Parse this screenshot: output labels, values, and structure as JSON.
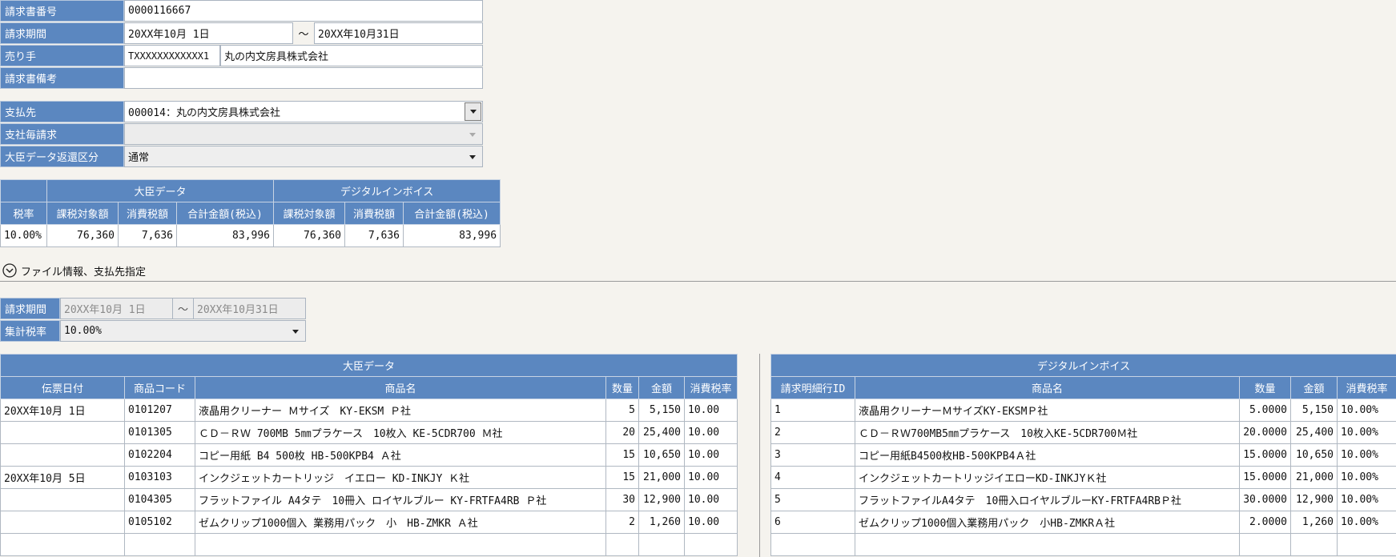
{
  "invoice": {
    "number_label": "請求書番号",
    "number": "0000116667",
    "period_label": "請求期間",
    "period_from": "20XX年10月 1日",
    "period_sep": "～",
    "period_to": "20XX年10月31日",
    "seller_label": "売り手",
    "seller_reg": "TXXXXXXXXXXXX1",
    "seller_name": "丸の内文房具株式会社",
    "remarks_label": "請求書備考",
    "remarks": ""
  },
  "payment": {
    "payee_label": "支払先",
    "payee_value": "000014：丸の内文房具株式会社",
    "branch_label": "支社毎請求",
    "branch_value": "",
    "return_label": "大臣データ返還区分",
    "return_value": "通常"
  },
  "summary": {
    "group_daijin": "大臣データ",
    "group_digital": "デジタルインボイス",
    "headers": [
      "税率",
      "課税対象額",
      "消費税額",
      "合計金額(税込)",
      "課税対象額",
      "消費税額",
      "合計金額(税込)"
    ],
    "row": [
      "10.00%",
      "76,360",
      "7,636",
      "83,996",
      "76,360",
      "7,636",
      "83,996"
    ]
  },
  "section_toggle": {
    "label": "ファイル情報、支払先指定"
  },
  "filter": {
    "period_label": "請求期間",
    "period_from": "20XX年10月 1日",
    "period_sep": "～",
    "period_to": "20XX年10月31日",
    "taxrate_label": "集計税率",
    "taxrate_value": "10.00%"
  },
  "daijin_table": {
    "title": "大臣データ",
    "headers": [
      "伝票日付",
      "商品コード",
      "商品名",
      "数量",
      "金額",
      "消費税率"
    ],
    "rows": [
      [
        "20XX年10月 1日",
        "0101207",
        "液晶用クリーナー Ｍサイズ　KY-EKSM Ｐ社",
        "5",
        "5,150",
        "10.00"
      ],
      [
        "",
        "0101305",
        "ＣＤ－ＲＷ 700MB 5㎜プラケース　10枚入 KE-5CDR700 Ｍ社",
        "20",
        "25,400",
        "10.00"
      ],
      [
        "",
        "0102204",
        "コピー用紙 B4 500枚 HB-500KPB4 Ａ社",
        "15",
        "10,650",
        "10.00"
      ],
      [
        "20XX年10月 5日",
        "0103103",
        "インクジェットカートリッジ　イエロー KD-INKJY Ｋ社",
        "15",
        "21,000",
        "10.00"
      ],
      [
        "",
        "0104305",
        "フラットファイル A4タテ　10冊入 ロイヤルブルー KY-FRTFA4RB Ｐ社",
        "30",
        "12,900",
        "10.00"
      ],
      [
        "",
        "0105102",
        "ゼムクリップ1000個入 業務用パック　小　HB-ZMKR Ａ社",
        "2",
        "1,260",
        "10.00"
      ],
      [
        "",
        "",
        "",
        "",
        "",
        ""
      ]
    ]
  },
  "digital_table": {
    "title": "デジタルインボイス",
    "headers": [
      "請求明細行ID",
      "商品名",
      "数量",
      "金額",
      "消費税率"
    ],
    "rows": [
      [
        "1",
        "液晶用クリーナーＭサイズKY-EKSMＰ社",
        "5.0000",
        "5,150",
        "10.00%"
      ],
      [
        "2",
        "ＣＤ－ＲＷ700MB5㎜プラケース　10枚入KE-5CDR700Ｍ社",
        "20.0000",
        "25,400",
        "10.00%"
      ],
      [
        "3",
        "コピー用紙B4500枚HB-500KPB4Ａ社",
        "15.0000",
        "10,650",
        "10.00%"
      ],
      [
        "4",
        "インクジェットカートリッジイエローKD-INKJYＫ社",
        "15.0000",
        "21,000",
        "10.00%"
      ],
      [
        "5",
        "フラットファイルA4タテ　10冊入ロイヤルブルーKY-FRTFA4RBＰ社",
        "30.0000",
        "12,900",
        "10.00%"
      ],
      [
        "6",
        "ゼムクリップ1000個入業務用パック　小HB-ZMKRＡ社",
        "2.0000",
        "1,260",
        "10.00%"
      ],
      [
        "",
        "",
        "",
        "",
        ""
      ]
    ]
  },
  "colors": {
    "header_blue": "#5b87c0",
    "background": "#f5f3ee"
  }
}
